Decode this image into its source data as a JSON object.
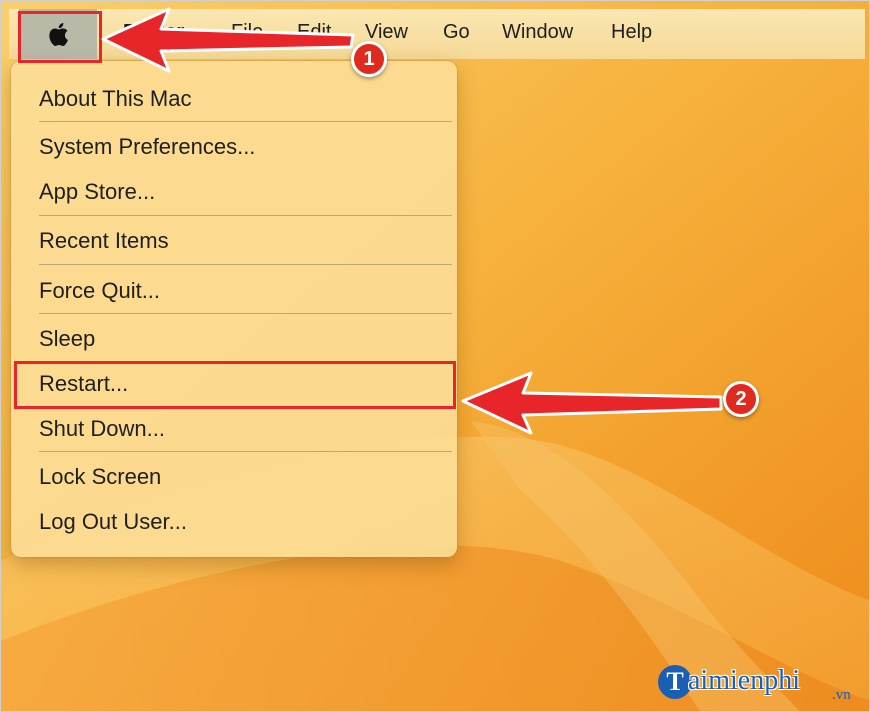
{
  "menubar": {
    "apple_icon": "apple-logo-icon",
    "items": [
      "Finder",
      "File",
      "Edit",
      "View",
      "Go",
      "Window",
      "Help"
    ]
  },
  "apple_menu": {
    "items": [
      {
        "label": "About This Mac"
      },
      {
        "label": "System Preferences..."
      },
      {
        "label": "App Store..."
      },
      {
        "label": "Recent Items"
      },
      {
        "label": "Force Quit..."
      },
      {
        "label": "Sleep"
      },
      {
        "label": "Restart..."
      },
      {
        "label": "Shut Down..."
      },
      {
        "label": "Lock Screen"
      },
      {
        "label": "Log Out User..."
      }
    ]
  },
  "annotations": {
    "step1": "1",
    "step2": "2",
    "color": "#e8262a"
  },
  "watermark": {
    "brand": "aimienphi",
    "tld": ".vn"
  },
  "colors": {
    "wallpaper": "#f3a32c",
    "menubar": "#f8e2a8",
    "apple_button_active": "#bab9a8",
    "annotation_red": "#e8262a",
    "watermark_blue": "#1a5fb4"
  }
}
